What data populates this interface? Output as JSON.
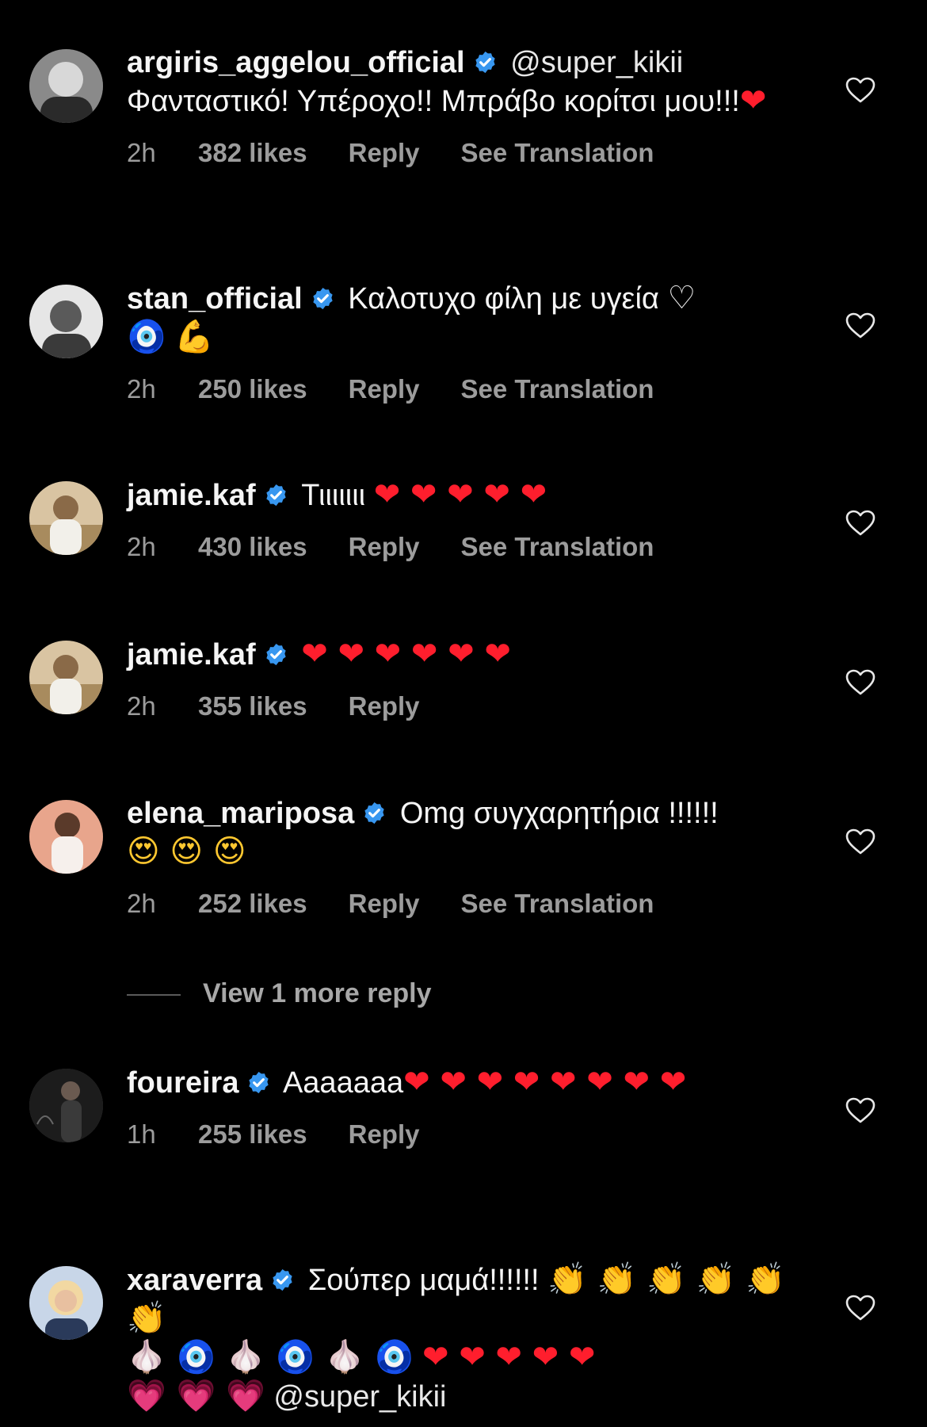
{
  "colors": {
    "background": "#000000",
    "text": "#f5f5f5",
    "meta": "#9c9c9c",
    "verified": "#3897f0"
  },
  "icons": {
    "verified": "verified-badge-icon",
    "like": "heart-outline-icon"
  },
  "comments": [
    {
      "username": "argiris_aggelou_official",
      "mention": "@super_kikii",
      "text": "Φανταστικό! Υπέροχο!! Μπράβο κορίτσι μου!!!",
      "emoji": "❤",
      "time": "2h",
      "likes": "382 likes",
      "reply": "Reply",
      "translation": "See Translation"
    },
    {
      "username": "stan_official",
      "text": "Καλοτυχο φίλη με υγεία",
      "emoji_1": "♡",
      "emoji_2": "🧿",
      "emoji_3": "💪",
      "time": "2h",
      "likes": "250 likes",
      "reply": "Reply",
      "translation": "See Translation"
    },
    {
      "username": "jamie.kaf",
      "text": "Τιιιιιιι",
      "emoji": "❤ ❤ ❤ ❤ ❤",
      "time": "2h",
      "likes": "430 likes",
      "reply": "Reply",
      "translation": "See Translation"
    },
    {
      "username": "jamie.kaf",
      "emoji": "❤ ❤ ❤ ❤ ❤ ❤",
      "time": "2h",
      "likes": "355 likes",
      "reply": "Reply"
    },
    {
      "username": "elena_mariposa",
      "text": "Omg συγχαρητήρια !!!!!!",
      "emoji": "😍 😍 😍",
      "time": "2h",
      "likes": "252 likes",
      "reply": "Reply",
      "translation": "See Translation"
    },
    {
      "username": "foureira",
      "text": "Aaaaaaa",
      "emoji": "❤ ❤ ❤ ❤ ❤ ❤ ❤ ❤",
      "time": "1h",
      "likes": "255 likes",
      "reply": "Reply"
    },
    {
      "username": "xaraverra",
      "text": "Σούπερ μαμά!!!!!!",
      "emoji_claps": "👏 👏 👏 👏 👏 👏",
      "emoji_mix": "🧄 🧿 🧄 🧿 🧄 🧿",
      "emoji_hearts": "❤ ❤ ❤ ❤ ❤",
      "emoji_pink": "💗 💗 💗",
      "mention": "@super_kikii"
    }
  ],
  "view_more": "View 1 more reply"
}
